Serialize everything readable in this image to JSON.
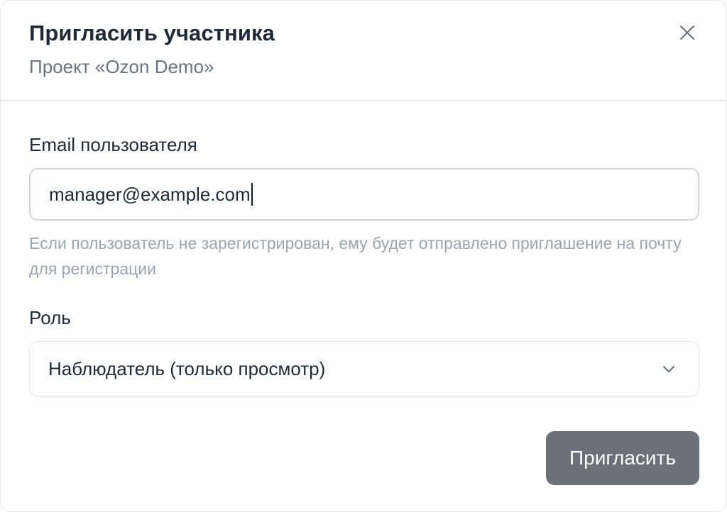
{
  "dialog": {
    "title": "Пригласить участника",
    "subtitle": "Проект «Ozon Demo»",
    "close_icon": "close-icon"
  },
  "email": {
    "label": "Email пользователя",
    "value": "manager@example.com",
    "hint": "Если пользователь не зарегистрирован, ему будет отправлено приглашение на почту для регистрации"
  },
  "role": {
    "label": "Роль",
    "selected": "Наблюдатель (только просмотр)",
    "icon": "chevron-down-icon"
  },
  "actions": {
    "invite_label": "Пригласить"
  },
  "colors": {
    "primary_button": "#6b7079",
    "text": "#1f2937",
    "muted": "#9ca3af"
  }
}
